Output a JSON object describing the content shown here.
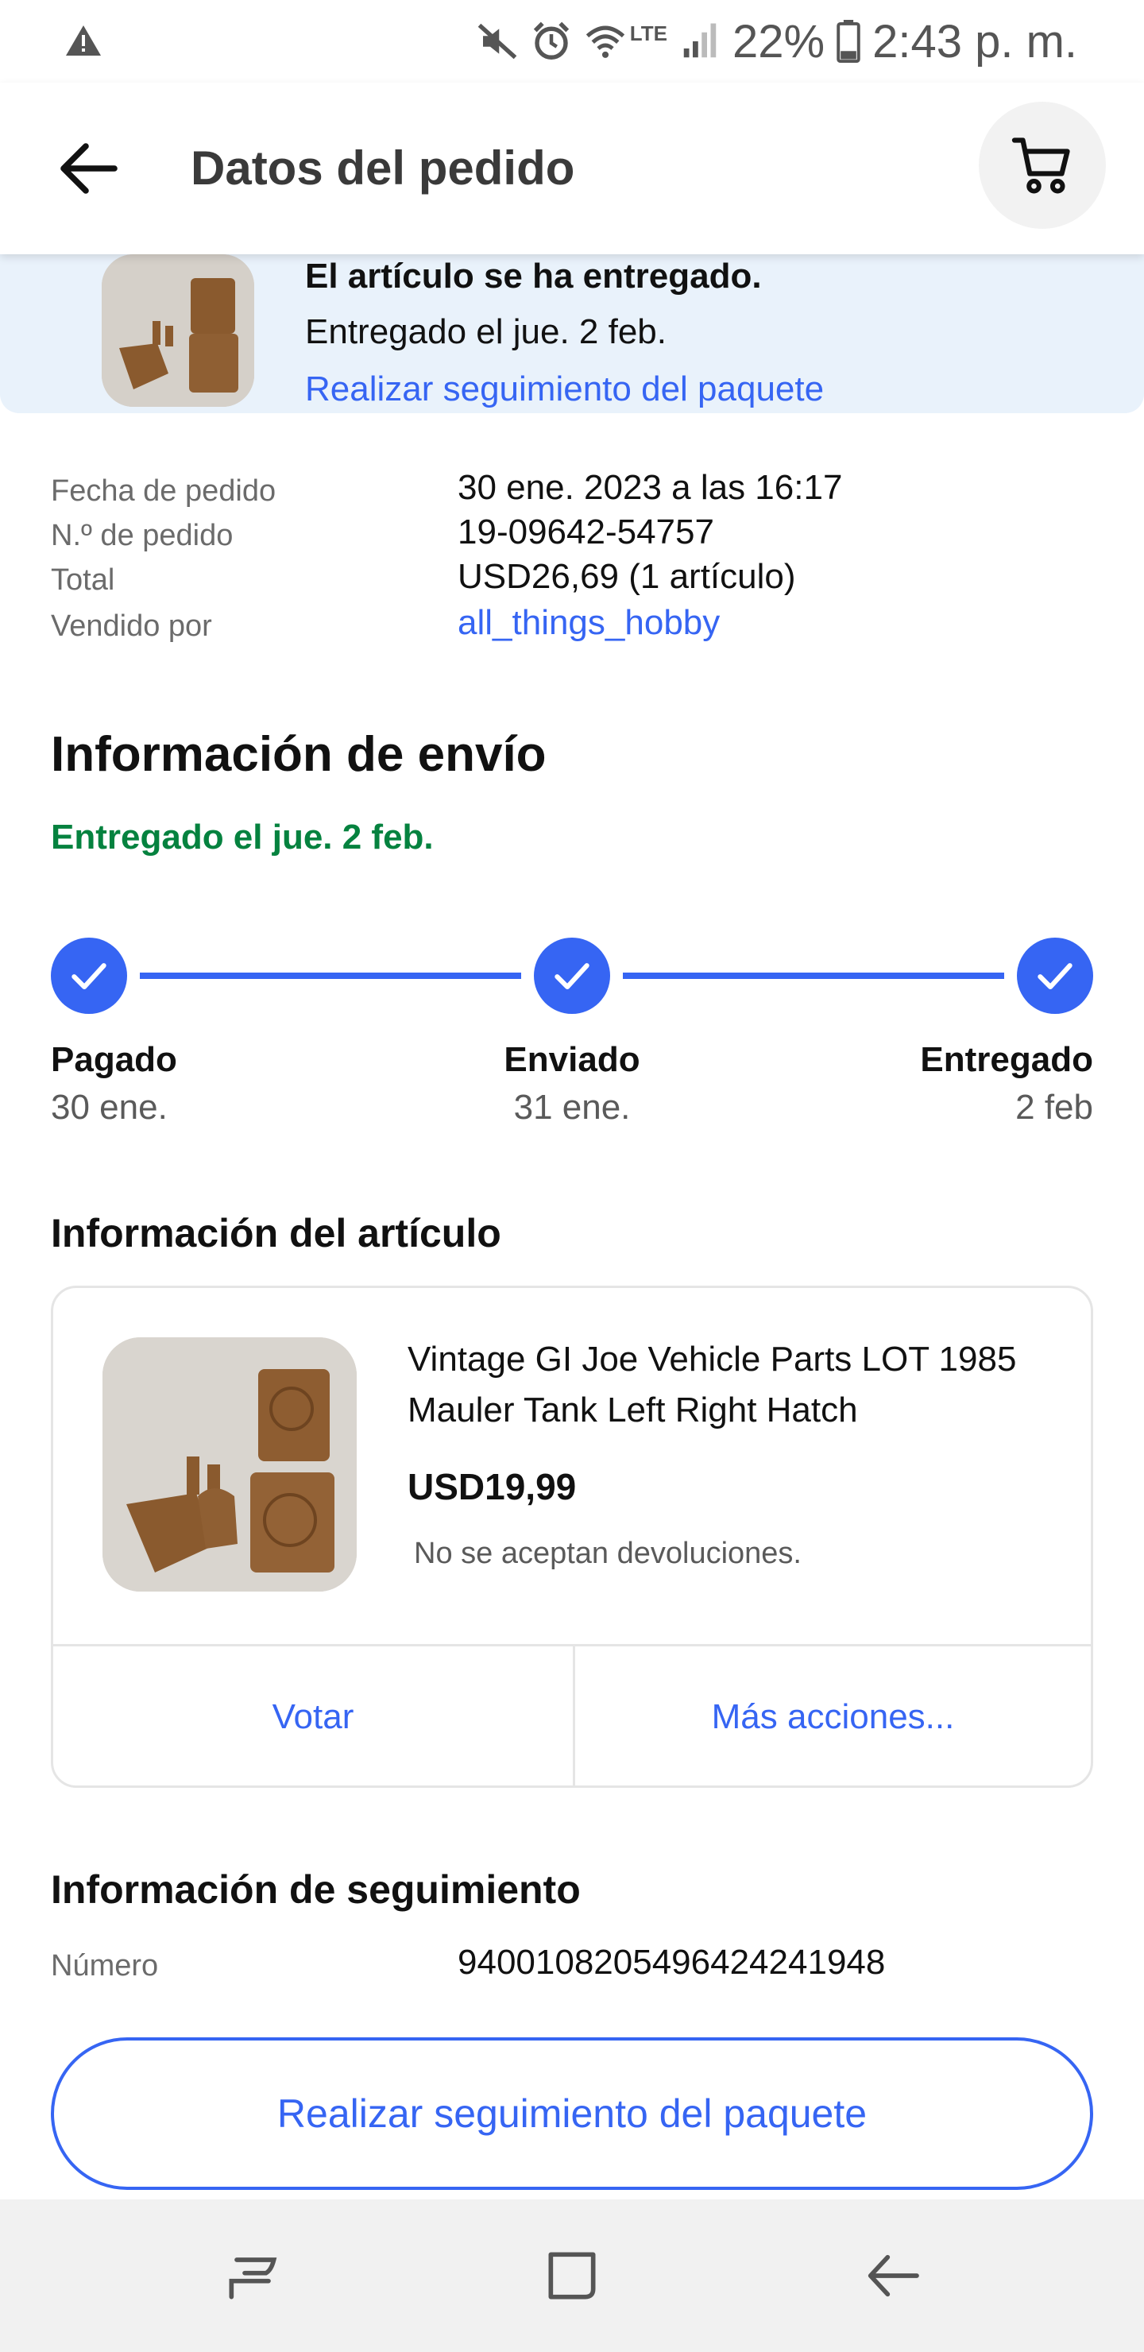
{
  "status_bar": {
    "battery_percent": "22%",
    "time": "2:43 p. m.",
    "network_label": "LTE",
    "icons": [
      "warning-icon",
      "mute-icon",
      "alarm-icon",
      "wifi-icon",
      "signal-icon",
      "battery-icon"
    ]
  },
  "header": {
    "title": "Datos del pedido",
    "back_icon": "arrow-left-icon",
    "cart_icon": "cart-icon"
  },
  "banner": {
    "status_title": "El artículo se ha entregado.",
    "delivered_text": "Entregado el jue. 2 feb.",
    "track_link": "Realizar seguimiento del paquete"
  },
  "order": {
    "date_label": "Fecha de pedido",
    "date_value": "30 ene. 2023 a las 16:17",
    "number_label": "N.º de pedido",
    "number_value": "19-09642-54757",
    "total_label": "Total",
    "total_value": "USD26,69 (1 artículo)",
    "seller_label": "Vendido por",
    "seller_value": "all_things_hobby"
  },
  "shipping": {
    "heading": "Información de envío",
    "status": "Entregado el jue. 2 feb.",
    "steps": [
      {
        "label": "Pagado",
        "date": "30 ene.",
        "done": true
      },
      {
        "label": "Enviado",
        "date": "31 ene.",
        "done": true
      },
      {
        "label": "Entregado",
        "date": "2 feb",
        "done": true
      }
    ]
  },
  "item": {
    "heading": "Información del artículo",
    "title": "Vintage GI Joe Vehicle Parts LOT 1985 Mauler Tank Left Right Hatch",
    "price": "USD19,99",
    "returns": "No se aceptan devoluciones.",
    "vote_label": "Votar",
    "more_label": "Más acciones..."
  },
  "tracking": {
    "heading": "Información de seguimiento",
    "number_label": "Número",
    "number_value": "9400108205496424241948",
    "button_label": "Realizar seguimiento del paquete"
  },
  "nav": {
    "icons": [
      "recent-apps-icon",
      "home-icon",
      "back-icon"
    ]
  },
  "colors": {
    "accent": "#3665f3",
    "success": "#05823f",
    "banner_bg": "#e9f2fb"
  }
}
